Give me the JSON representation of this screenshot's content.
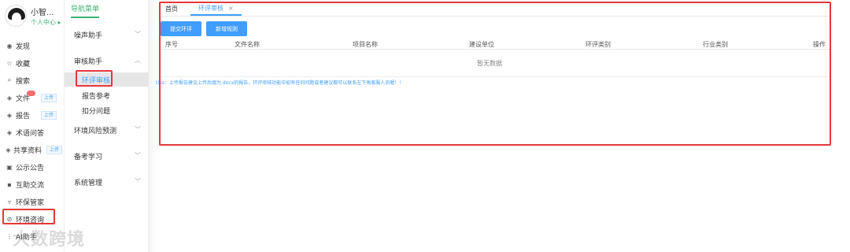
{
  "profile": {
    "username": "小智...",
    "usercenter": "个人中心 ▸"
  },
  "rail": {
    "items": [
      {
        "icon": "◉",
        "label": "发现",
        "tag": ""
      },
      {
        "icon": "☆",
        "label": "收藏",
        "tag": ""
      },
      {
        "icon": "⌕",
        "label": "搜索",
        "tag": ""
      },
      {
        "icon": "◈",
        "label": "文件",
        "tag": "上传"
      },
      {
        "icon": "◈",
        "label": "报告",
        "tag": "上传"
      },
      {
        "icon": "◈",
        "label": "术语问答",
        "tag": ""
      },
      {
        "icon": "◈",
        "label": "共享资料",
        "tag": "上传"
      },
      {
        "icon": "▣",
        "label": "公示公告",
        "tag": ""
      },
      {
        "icon": "▪",
        "label": "互助交流",
        "tag": ""
      },
      {
        "icon": "▿",
        "label": "环保管家",
        "tag": ""
      },
      {
        "icon": "⊘",
        "label": "环境咨询",
        "tag": ""
      },
      {
        "icon": "⋮",
        "label": "AI助手",
        "tag": ""
      }
    ]
  },
  "menu": {
    "title": "导航菜单",
    "groups": [
      {
        "label": "噪声助手",
        "chev": "﹀"
      },
      {
        "label": "审核助手",
        "chev": "︿"
      },
      {
        "label": "环境风险预测",
        "chev": "﹀"
      },
      {
        "label": "备考学习",
        "chev": "﹀"
      },
      {
        "label": "系统管理",
        "chev": "﹀"
      }
    ],
    "subitems": [
      "环评审核",
      "报告参考",
      "扣分问题"
    ]
  },
  "tabs": [
    {
      "label": "首页"
    },
    {
      "label": "环评审核",
      "close": "×"
    }
  ],
  "toolbar": {
    "submit_label": "提交环评",
    "new_rule_label": "新增规则"
  },
  "table": {
    "headers": [
      "序号",
      "文件名称",
      "项目名称",
      "建设单位",
      "环评类别",
      "行业类别",
      "操作"
    ],
    "empty_text": "暂无数据"
  },
  "tip": "tips：上传报告建议上传后缀为.docx的报告，环评审核功能中如有任何问题或者建议都可以联系左下角客服人员喔！！",
  "watermark": "大数跨境",
  "colors": {
    "accent": "#409eff",
    "menu_green": "#3cb371",
    "annotation_red": "#e5383b"
  }
}
